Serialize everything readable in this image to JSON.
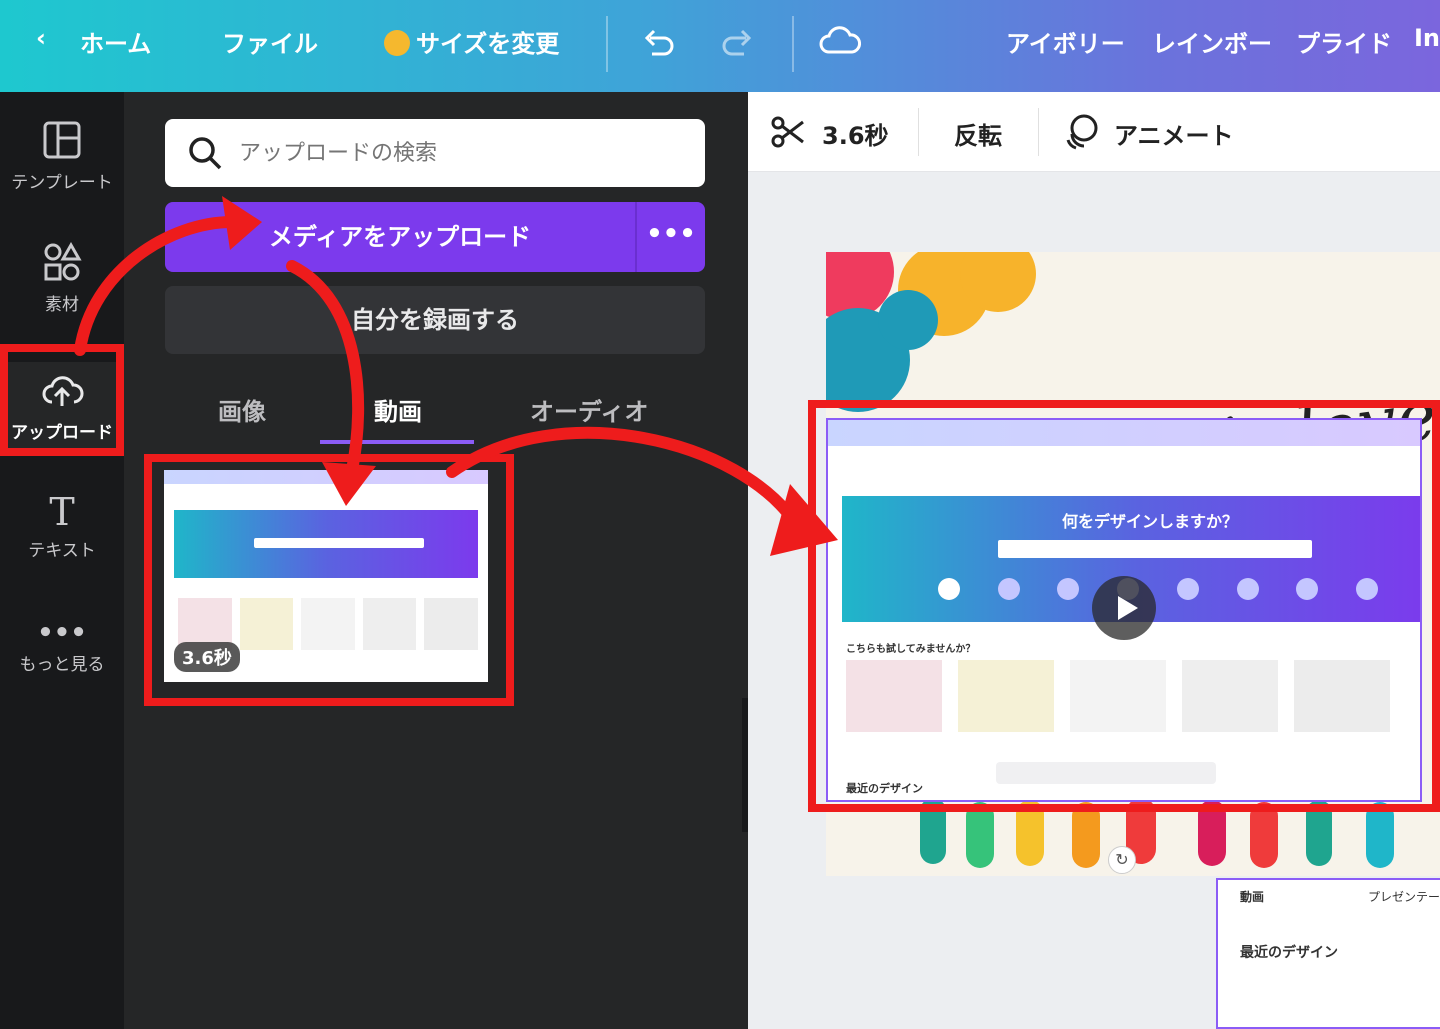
{
  "topbar": {
    "home": "ホーム",
    "file": "ファイル",
    "resize": "サイズを変更",
    "colors": [
      "アイボリー",
      "レインボー",
      "プライド"
    ],
    "cutoff": "In"
  },
  "rail": {
    "templates": "テンプレート",
    "elements": "素材",
    "uploads": "アップロード",
    "text": "テキスト",
    "more": "もっと見る"
  },
  "panel": {
    "search_placeholder": "アップロードの検索",
    "upload_button": "メディアをアップロード",
    "more_button": "•••",
    "record_button": "自分を録画する",
    "tabs": [
      "画像",
      "動画",
      "オーディオ"
    ],
    "active_tab": "動画",
    "video_duration": "3.6秒"
  },
  "editor_toolbar": {
    "duration": "3.6秒",
    "flip": "反転",
    "animate": "アニメート"
  },
  "canvas": {
    "lettering": "Love is love!",
    "video_heading": "何をデザインしますか？",
    "recent_label": "最近のデザイン",
    "section_label": "こちらも試してみませんか？",
    "lower_label": "動画",
    "lower_label2": "プレゼンテー"
  },
  "colors": {
    "accent": "#7c3aed",
    "highlight": "#ee1c1c"
  }
}
